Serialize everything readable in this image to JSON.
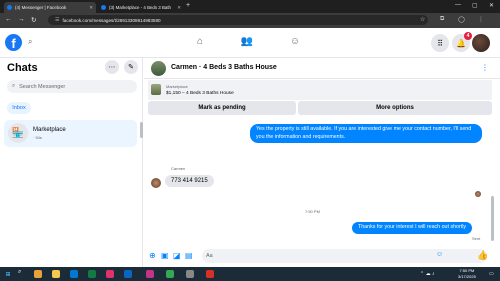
{
  "browser": {
    "tabs": [
      {
        "title": "(4) Messenger | Facebook",
        "active": true
      },
      {
        "title": "(3) Marketplace - 4 Beds 3 Bath",
        "active": false
      }
    ],
    "new_tab_icon": "+",
    "url": "facebook.com/messages/t/28913308614983580",
    "window_controls": [
      "—",
      "▢",
      "✕"
    ]
  },
  "fb": {
    "notification_count": "4",
    "icons": [
      "home-icon",
      "friends-icon",
      "groups-icon",
      "menu-grid-icon",
      "bell-icon"
    ]
  },
  "sidebar": {
    "title": "Chats",
    "search_placeholder": "Search Messenger",
    "inbox_label": "Inbox",
    "conversations": [
      {
        "name": "Marketplace",
        "subtitle": "· 54s"
      }
    ]
  },
  "conversation": {
    "title": "Carmen · 4 Beds 3 Baths House",
    "listing": {
      "label": "Marketplace",
      "price_title": "$1,150 – 4 Beds 3 Baths House"
    },
    "actions": {
      "mark_pending": "Mark as pending",
      "more_options": "More options"
    },
    "messages": [
      {
        "from": "me",
        "text": "Yes the property is still available. If you are interested  give me your contact number, I'll send you the information and requirements."
      },
      {
        "from": "Carmen",
        "text": "773 414 9215"
      },
      {
        "from": "me",
        "text": "Thanks for your interest I will reach out shortly"
      }
    ],
    "sender_label": "Carmen",
    "time_separator": "7:50 PM",
    "sent_label": "Sent",
    "composer_placeholder": "Aa"
  },
  "taskbar": {
    "time": "7:50 PM",
    "date": "3/17/2025"
  }
}
